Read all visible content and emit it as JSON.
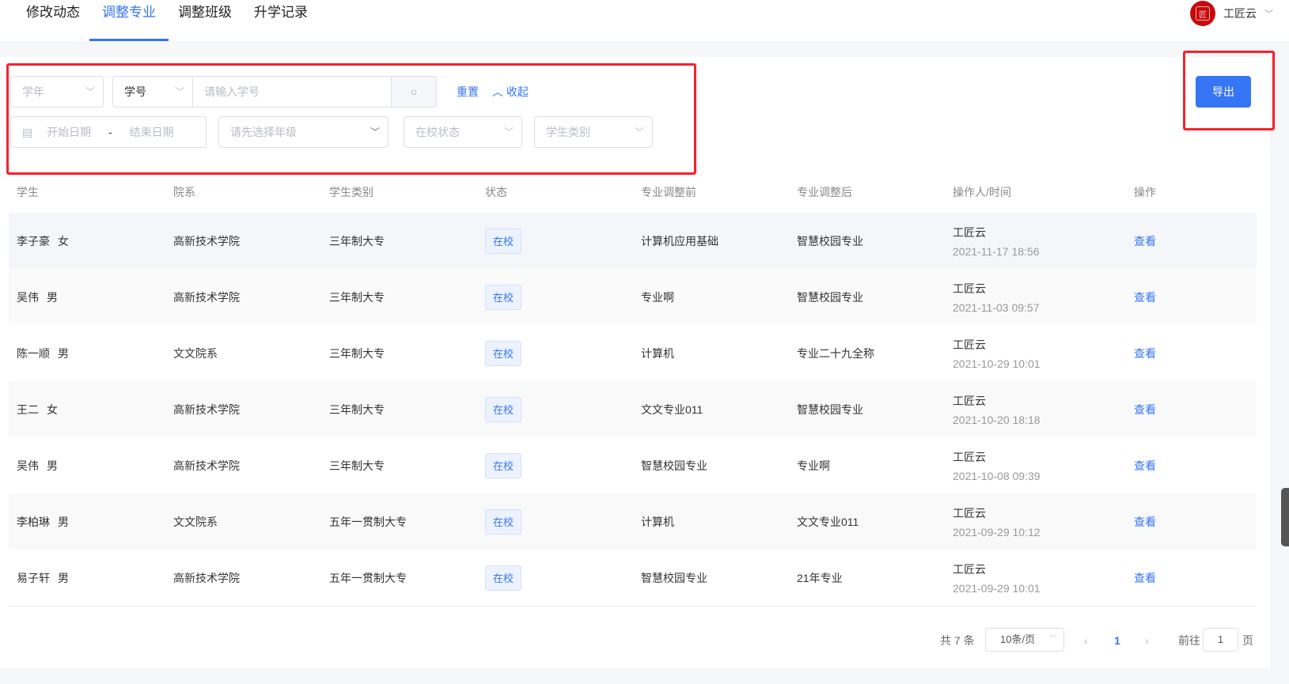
{
  "tabs": [
    "修改动态",
    "调整专业",
    "调整班级",
    "升学记录"
  ],
  "user": {
    "name": "工匠云",
    "logo_text": "匠"
  },
  "filters": {
    "year": "学年",
    "id_type": "学号",
    "id_placeholder": "请输入学号",
    "reset": "重置",
    "collapse": "收起",
    "start_date": "开始日期",
    "date_sep": "-",
    "end_date": "结束日期",
    "grade": "请先选择年级",
    "status": "在校状态",
    "category": "学生类别"
  },
  "export_label": "导出",
  "columns": [
    "学生",
    "院系",
    "学生类别",
    "状态",
    "专业调整前",
    "专业调整后",
    "操作人/时间",
    "操作"
  ],
  "rows": [
    {
      "name": "李子豪",
      "gender": "女",
      "dept": "高新技术学院",
      "type": "三年制大专",
      "status": "在校",
      "before": "计算机应用基础",
      "after": "智慧校园专业",
      "operator": "工匠云",
      "time": "2021-11-17 18:56",
      "action": "查看"
    },
    {
      "name": "吴伟",
      "gender": "男",
      "dept": "高新技术学院",
      "type": "三年制大专",
      "status": "在校",
      "before": "专业啊",
      "after": "智慧校园专业",
      "operator": "工匠云",
      "time": "2021-11-03 09:57",
      "action": "查看"
    },
    {
      "name": "陈一顺",
      "gender": "男",
      "dept": "文文院系",
      "type": "三年制大专",
      "status": "在校",
      "before": "计算机",
      "after": "专业二十九全称",
      "operator": "工匠云",
      "time": "2021-10-29 10:01",
      "action": "查看"
    },
    {
      "name": "王二",
      "gender": "女",
      "dept": "高新技术学院",
      "type": "三年制大专",
      "status": "在校",
      "before": "文文专业011",
      "after": "智慧校园专业",
      "operator": "工匠云",
      "time": "2021-10-20 18:18",
      "action": "查看"
    },
    {
      "name": "吴伟",
      "gender": "男",
      "dept": "高新技术学院",
      "type": "三年制大专",
      "status": "在校",
      "before": "智慧校园专业",
      "after": "专业啊",
      "operator": "工匠云",
      "time": "2021-10-08 09:39",
      "action": "查看"
    },
    {
      "name": "李柏琳",
      "gender": "男",
      "dept": "文文院系",
      "type": "五年一贯制大专",
      "status": "在校",
      "before": "计算机",
      "after": "文文专业011",
      "operator": "工匠云",
      "time": "2021-09-29 10:12",
      "action": "查看"
    },
    {
      "name": "易子轩",
      "gender": "男",
      "dept": "高新技术学院",
      "type": "五年一贯制大专",
      "status": "在校",
      "before": "智慧校园专业",
      "after": "21年专业",
      "operator": "工匠云",
      "time": "2021-09-29 10:01",
      "action": "查看"
    }
  ],
  "pagination": {
    "total": "共 7 条",
    "page_size": "10条/页",
    "current": "1",
    "goto_label": "前往",
    "goto_value": "1",
    "page_suffix": "页"
  },
  "colors": {
    "accent": "#3575f6",
    "highlight": "#f5222d"
  }
}
